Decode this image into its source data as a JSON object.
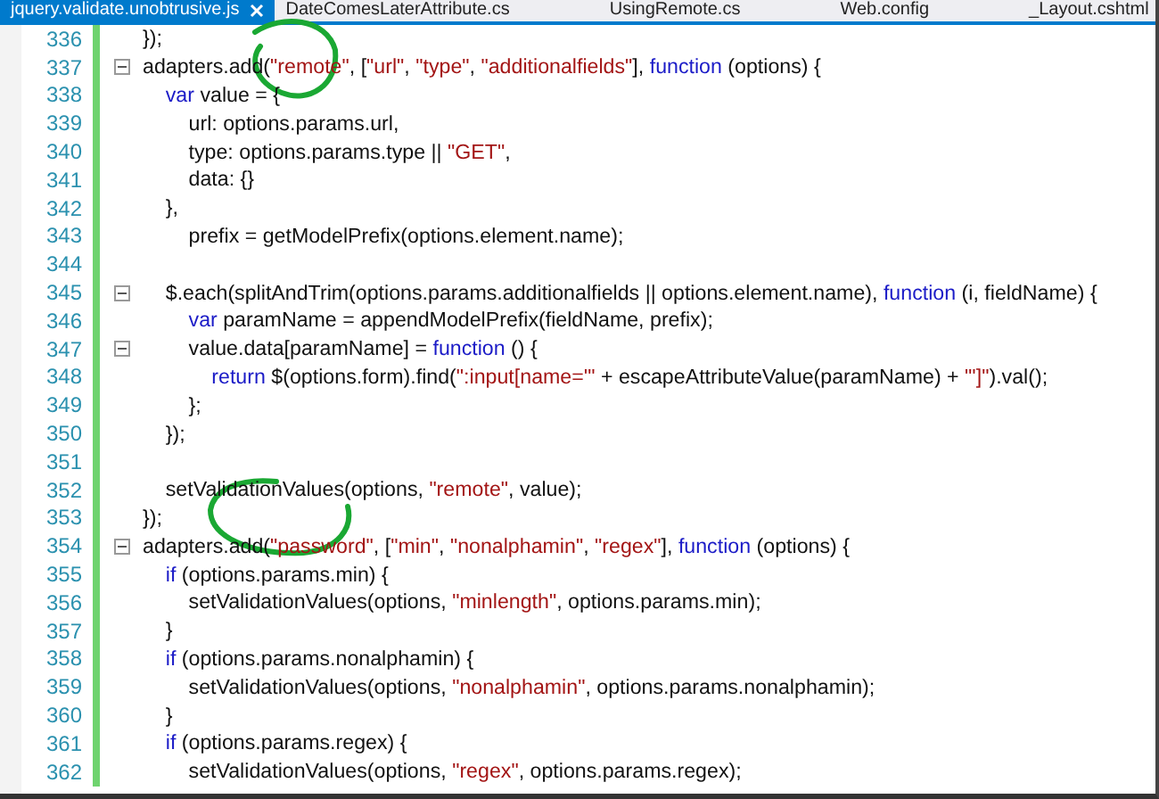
{
  "tabs": [
    {
      "label": "jquery.validate.unobtrusive.js",
      "selected": true
    },
    {
      "label": "DateComesLaterAttribute.cs",
      "selected": false
    },
    {
      "label": "UsingRemote.cs",
      "selected": false
    },
    {
      "label": "Web.config",
      "selected": false
    },
    {
      "label": "_Layout.cshtml",
      "selected": false
    }
  ],
  "lines": [
    {
      "number": "336",
      "foldable": false,
      "tokens": [
        {
          "kind": "plain",
          "text": "});"
        }
      ]
    },
    {
      "number": "337",
      "foldable": true,
      "tokens": [
        {
          "kind": "plain",
          "text": "adapters.add("
        },
        {
          "kind": "string",
          "text": "\"remote\""
        },
        {
          "kind": "plain",
          "text": ", ["
        },
        {
          "kind": "string",
          "text": "\"url\""
        },
        {
          "kind": "plain",
          "text": ", "
        },
        {
          "kind": "string",
          "text": "\"type\""
        },
        {
          "kind": "plain",
          "text": ", "
        },
        {
          "kind": "string",
          "text": "\"additionalfields\""
        },
        {
          "kind": "plain",
          "text": "], "
        },
        {
          "kind": "keyword",
          "text": "function"
        },
        {
          "kind": "plain",
          "text": " (options) {"
        }
      ]
    },
    {
      "number": "338",
      "foldable": false,
      "tokens": [
        {
          "kind": "keyword",
          "text": "    var"
        },
        {
          "kind": "plain",
          "text": " value = {"
        }
      ]
    },
    {
      "number": "339",
      "foldable": false,
      "tokens": [
        {
          "kind": "plain",
          "text": "        url: options.params.url,"
        }
      ]
    },
    {
      "number": "340",
      "foldable": false,
      "tokens": [
        {
          "kind": "plain",
          "text": "        type: options.params.type || "
        },
        {
          "kind": "string",
          "text": "\"GET\""
        },
        {
          "kind": "plain",
          "text": ","
        }
      ]
    },
    {
      "number": "341",
      "foldable": false,
      "tokens": [
        {
          "kind": "plain",
          "text": "        data: {}"
        }
      ]
    },
    {
      "number": "342",
      "foldable": false,
      "tokens": [
        {
          "kind": "plain",
          "text": "    },"
        }
      ]
    },
    {
      "number": "343",
      "foldable": false,
      "tokens": [
        {
          "kind": "plain",
          "text": "        prefix = getModelPrefix(options.element.name);"
        }
      ]
    },
    {
      "number": "344",
      "foldable": false
    },
    {
      "number": "345",
      "foldable": true,
      "tokens": [
        {
          "kind": "plain",
          "text": "    $.each(splitAndTrim(options.params.additionalfields || options.element.name), "
        },
        {
          "kind": "keyword",
          "text": "function"
        },
        {
          "kind": "plain",
          "text": " (i, fieldName) {"
        }
      ]
    },
    {
      "number": "346",
      "foldable": false,
      "tokens": [
        {
          "kind": "keyword",
          "text": "        var"
        },
        {
          "kind": "plain",
          "text": " paramName = appendModelPrefix(fieldName, prefix);"
        }
      ]
    },
    {
      "number": "347",
      "foldable": true,
      "tokens": [
        {
          "kind": "plain",
          "text": "        value.data[paramName] = "
        },
        {
          "kind": "keyword",
          "text": "function"
        },
        {
          "kind": "plain",
          "text": " () {"
        }
      ]
    },
    {
      "number": "348",
      "foldable": false,
      "tokens": [
        {
          "kind": "keyword",
          "text": "            return"
        },
        {
          "kind": "plain",
          "text": " $(options.form).find("
        },
        {
          "kind": "string",
          "text": "\":input[name='\""
        },
        {
          "kind": "plain",
          "text": " + escapeAttributeValue(paramName) + "
        },
        {
          "kind": "string",
          "text": "\"']\""
        },
        {
          "kind": "plain",
          "text": ").val();"
        }
      ]
    },
    {
      "number": "349",
      "foldable": false,
      "tokens": [
        {
          "kind": "plain",
          "text": "        };"
        }
      ]
    },
    {
      "number": "350",
      "foldable": false,
      "tokens": [
        {
          "kind": "plain",
          "text": "    });"
        }
      ]
    },
    {
      "number": "351",
      "foldable": false
    },
    {
      "number": "352",
      "foldable": false,
      "tokens": [
        {
          "kind": "plain",
          "text": "    setValidationValues(options, "
        },
        {
          "kind": "string",
          "text": "\"remote\""
        },
        {
          "kind": "plain",
          "text": ", value);"
        }
      ]
    },
    {
      "number": "353",
      "foldable": false,
      "tokens": [
        {
          "kind": "plain",
          "text": "});"
        }
      ]
    },
    {
      "number": "354",
      "foldable": true,
      "tokens": [
        {
          "kind": "plain",
          "text": "adapters.add("
        },
        {
          "kind": "string",
          "text": "\"password\""
        },
        {
          "kind": "plain",
          "text": ", ["
        },
        {
          "kind": "string",
          "text": "\"min\""
        },
        {
          "kind": "plain",
          "text": ", "
        },
        {
          "kind": "string",
          "text": "\"nonalphamin\""
        },
        {
          "kind": "plain",
          "text": ", "
        },
        {
          "kind": "string",
          "text": "\"regex\""
        },
        {
          "kind": "plain",
          "text": "], "
        },
        {
          "kind": "keyword",
          "text": "function"
        },
        {
          "kind": "plain",
          "text": " (options) {"
        }
      ]
    },
    {
      "number": "355",
      "foldable": false,
      "tokens": [
        {
          "kind": "keyword",
          "text": "    if"
        },
        {
          "kind": "plain",
          "text": " (options.params.min) {"
        }
      ]
    },
    {
      "number": "356",
      "foldable": false,
      "tokens": [
        {
          "kind": "plain",
          "text": "        setValidationValues(options, "
        },
        {
          "kind": "string",
          "text": "\"minlength\""
        },
        {
          "kind": "plain",
          "text": ", options.params.min);"
        }
      ]
    },
    {
      "number": "357",
      "foldable": false,
      "tokens": [
        {
          "kind": "plain",
          "text": "    }"
        }
      ]
    },
    {
      "number": "358",
      "foldable": false,
      "tokens": [
        {
          "kind": "keyword",
          "text": "    if"
        },
        {
          "kind": "plain",
          "text": " (options.params.nonalphamin) {"
        }
      ]
    },
    {
      "number": "359",
      "foldable": false,
      "tokens": [
        {
          "kind": "plain",
          "text": "        setValidationValues(options, "
        },
        {
          "kind": "string",
          "text": "\"nonalphamin\""
        },
        {
          "kind": "plain",
          "text": ", options.params.nonalphamin);"
        }
      ]
    },
    {
      "number": "360",
      "foldable": false,
      "tokens": [
        {
          "kind": "plain",
          "text": "    }"
        }
      ]
    },
    {
      "number": "361",
      "foldable": false,
      "tokens": [
        {
          "kind": "keyword",
          "text": "    if"
        },
        {
          "kind": "plain",
          "text": " (options.params.regex) {"
        }
      ]
    },
    {
      "number": "362",
      "foldable": false,
      "tokens": [
        {
          "kind": "plain",
          "text": "        setValidationValues(options, "
        },
        {
          "kind": "string",
          "text": "\"regex\""
        },
        {
          "kind": "plain",
          "text": ", options.params.regex);"
        }
      ]
    }
  ]
}
